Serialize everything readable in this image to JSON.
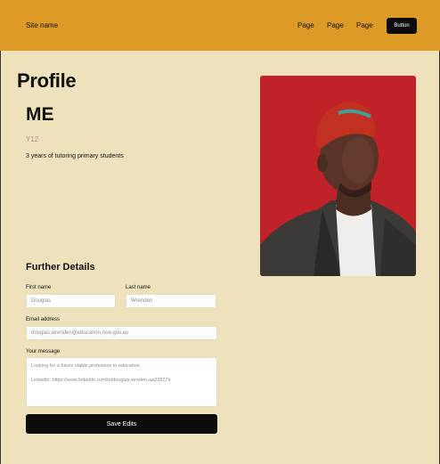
{
  "header": {
    "site_name": "Site name",
    "nav": [
      "Page",
      "Page",
      "Page"
    ],
    "button_label": "Button"
  },
  "profile": {
    "title": "Profile",
    "name": "ME",
    "year": "Y12",
    "bio": "3 years of tutoring primary students"
  },
  "details": {
    "title": "Further Details",
    "first_name_label": "First name",
    "first_name_value": "Douglas",
    "last_name_label": "Last name",
    "last_name_value": "Wrenden",
    "email_label": "Email address",
    "email_value": "douglas.wrenden@education.nsw.gov.au",
    "message_label": "Your message",
    "message_line1": "Looking for a future stable profession in education",
    "message_line2": "Linkedin: https://www.linkedin.com/in/douglas-wreden-aa22827b",
    "save_label": "Save Edits"
  },
  "colors": {
    "header_bg": "#dc9a26",
    "page_bg": "#f0e1bd",
    "button_bg": "#0c0c0c",
    "photo_bg": "#c8262a"
  }
}
